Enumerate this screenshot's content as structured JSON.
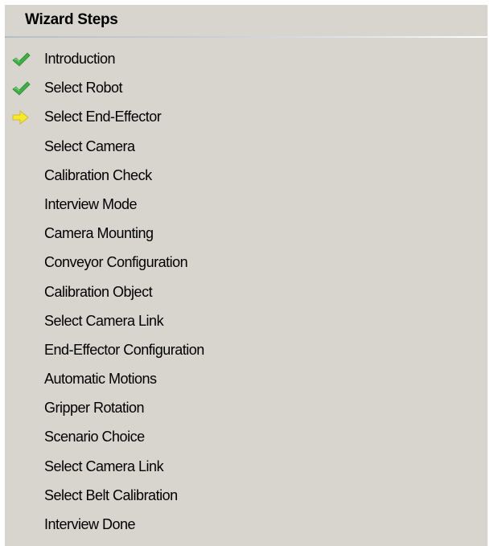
{
  "panel": {
    "title": "Wizard Steps"
  },
  "colors": {
    "panel_background": "#d8d4ce",
    "completed_icon": "#3cb043",
    "current_icon": "#f5e92a"
  },
  "steps": [
    {
      "label": "Introduction",
      "status": "completed",
      "icon": "checkmark-icon"
    },
    {
      "label": "Select Robot",
      "status": "completed",
      "icon": "checkmark-icon"
    },
    {
      "label": "Select End-Effector",
      "status": "current",
      "icon": "arrow-right-icon"
    },
    {
      "label": "Select Camera",
      "status": "pending",
      "icon": ""
    },
    {
      "label": "Calibration Check",
      "status": "pending",
      "icon": ""
    },
    {
      "label": "Interview Mode",
      "status": "pending",
      "icon": ""
    },
    {
      "label": "Camera Mounting",
      "status": "pending",
      "icon": ""
    },
    {
      "label": "Conveyor Configuration",
      "status": "pending",
      "icon": ""
    },
    {
      "label": "Calibration Object",
      "status": "pending",
      "icon": ""
    },
    {
      "label": "Select Camera Link",
      "status": "pending",
      "icon": ""
    },
    {
      "label": "End-Effector Configuration",
      "status": "pending",
      "icon": ""
    },
    {
      "label": "Automatic Motions",
      "status": "pending",
      "icon": ""
    },
    {
      "label": "Gripper Rotation",
      "status": "pending",
      "icon": ""
    },
    {
      "label": "Scenario Choice",
      "status": "pending",
      "icon": ""
    },
    {
      "label": "Select Camera Link",
      "status": "pending",
      "icon": ""
    },
    {
      "label": "Select Belt Calibration",
      "status": "pending",
      "icon": ""
    },
    {
      "label": "Interview Done",
      "status": "pending",
      "icon": ""
    }
  ]
}
